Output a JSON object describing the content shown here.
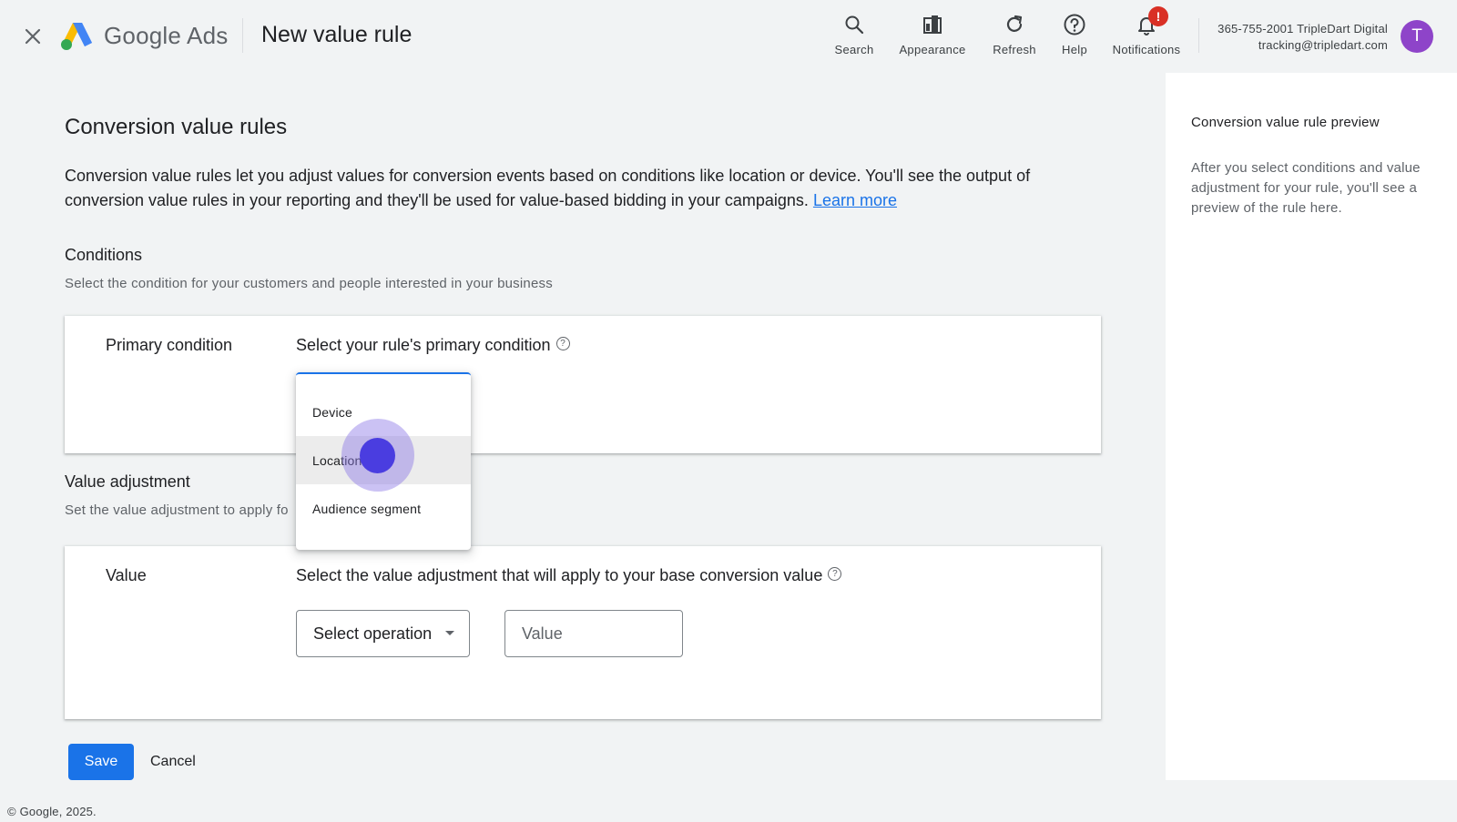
{
  "header": {
    "brand": "Google Ads",
    "page_title": "New value rule",
    "tools": [
      {
        "label": "Search",
        "icon": "search-icon"
      },
      {
        "label": "Appearance",
        "icon": "appearance-icon"
      },
      {
        "label": "Refresh",
        "icon": "refresh-icon"
      },
      {
        "label": "Help",
        "icon": "help-icon"
      },
      {
        "label": "Notifications",
        "icon": "bell-icon",
        "badge": "!"
      }
    ],
    "account": {
      "line1": "365-755-2001 TripleDart Digital",
      "line2": "tracking@tripledart.com",
      "avatar_letter": "T",
      "avatar_color": "#8e44c9"
    }
  },
  "main": {
    "heading": "Conversion value rules",
    "intro": "Conversion value rules let you adjust values for conversion events based on conditions like location or device. You'll see the output of conversion value rules in your reporting and they'll be used for value-based bidding in your campaigns.",
    "learn_more": "Learn more",
    "conditions": {
      "title": "Conditions",
      "description": "Select the condition for your customers and people interested in your business",
      "card_label": "Primary condition",
      "prompt": "Select your rule's primary condition",
      "dropdown_options": [
        "Device",
        "Location",
        "Audience segment"
      ],
      "highlighted_option": "Location"
    },
    "value_adjustment": {
      "title": "Value adjustment",
      "description": "Set the value adjustment to apply fo",
      "card_label": "Value",
      "prompt": "Select the value adjustment that will apply to your base conversion value",
      "operation_label": "Select operation",
      "value_placeholder": "Value"
    },
    "save_label": "Save",
    "cancel_label": "Cancel"
  },
  "side_panel": {
    "title": "Conversion value rule preview",
    "text": "After you select conditions and value adjustment for your rule, you'll see a preview of the rule here."
  },
  "footer": "© Google, 2025.",
  "colors": {
    "accent": "#1a73e8",
    "badge": "#d93025",
    "background": "#f1f3f4"
  }
}
